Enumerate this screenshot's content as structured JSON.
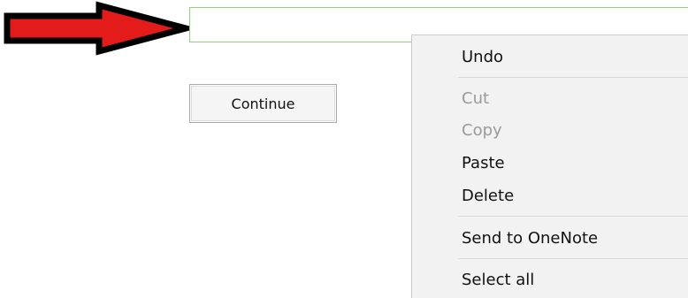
{
  "form": {
    "input": {
      "value": "",
      "placeholder": ""
    },
    "continue_label": "Continue"
  },
  "annotation": {
    "arrow_icon": "red-arrow-right",
    "arrow_color": "#e31b1b",
    "arrow_outline_color": "#000000"
  },
  "context_menu": {
    "items": [
      {
        "label": "Undo",
        "enabled": true
      },
      {
        "label": "Cut",
        "enabled": false
      },
      {
        "label": "Copy",
        "enabled": false
      },
      {
        "label": "Paste",
        "enabled": true
      },
      {
        "label": "Delete",
        "enabled": true
      },
      {
        "label": "Send to OneNote",
        "enabled": true
      },
      {
        "label": "Select all",
        "enabled": true
      }
    ]
  },
  "colors": {
    "input_border": "#8fd27a",
    "menu_background": "#f2f2f2",
    "disabled_text": "#9a9a9a"
  }
}
